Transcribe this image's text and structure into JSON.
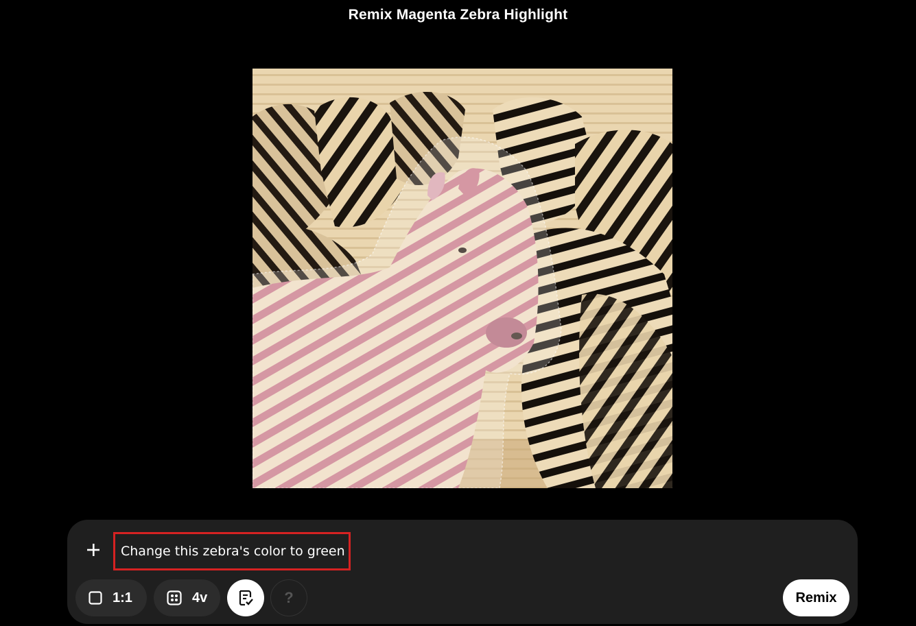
{
  "page": {
    "title": "Remix Magenta Zebra Highlight"
  },
  "canvas": {
    "image_subject": "herd of pixelated zebras with one zebra highlighted in pink",
    "selection": "highlighted zebra mask"
  },
  "composer": {
    "prompt_value": "Change this zebra's color to green",
    "add_icon": "plus-icon",
    "aspect": {
      "icon": "square-icon",
      "label": "1:1"
    },
    "variants": {
      "icon": "grid-dots-icon",
      "label": "4v"
    },
    "prompt_helper_icon": "document-check-icon",
    "help_label": "?",
    "remix_label": "Remix"
  },
  "colors": {
    "background": "#000000",
    "composer_bg": "#1f1f1f",
    "pill_bg": "#2c2c2c",
    "highlight_border": "#d62222",
    "zebra_highlight": "#c97a8a"
  }
}
